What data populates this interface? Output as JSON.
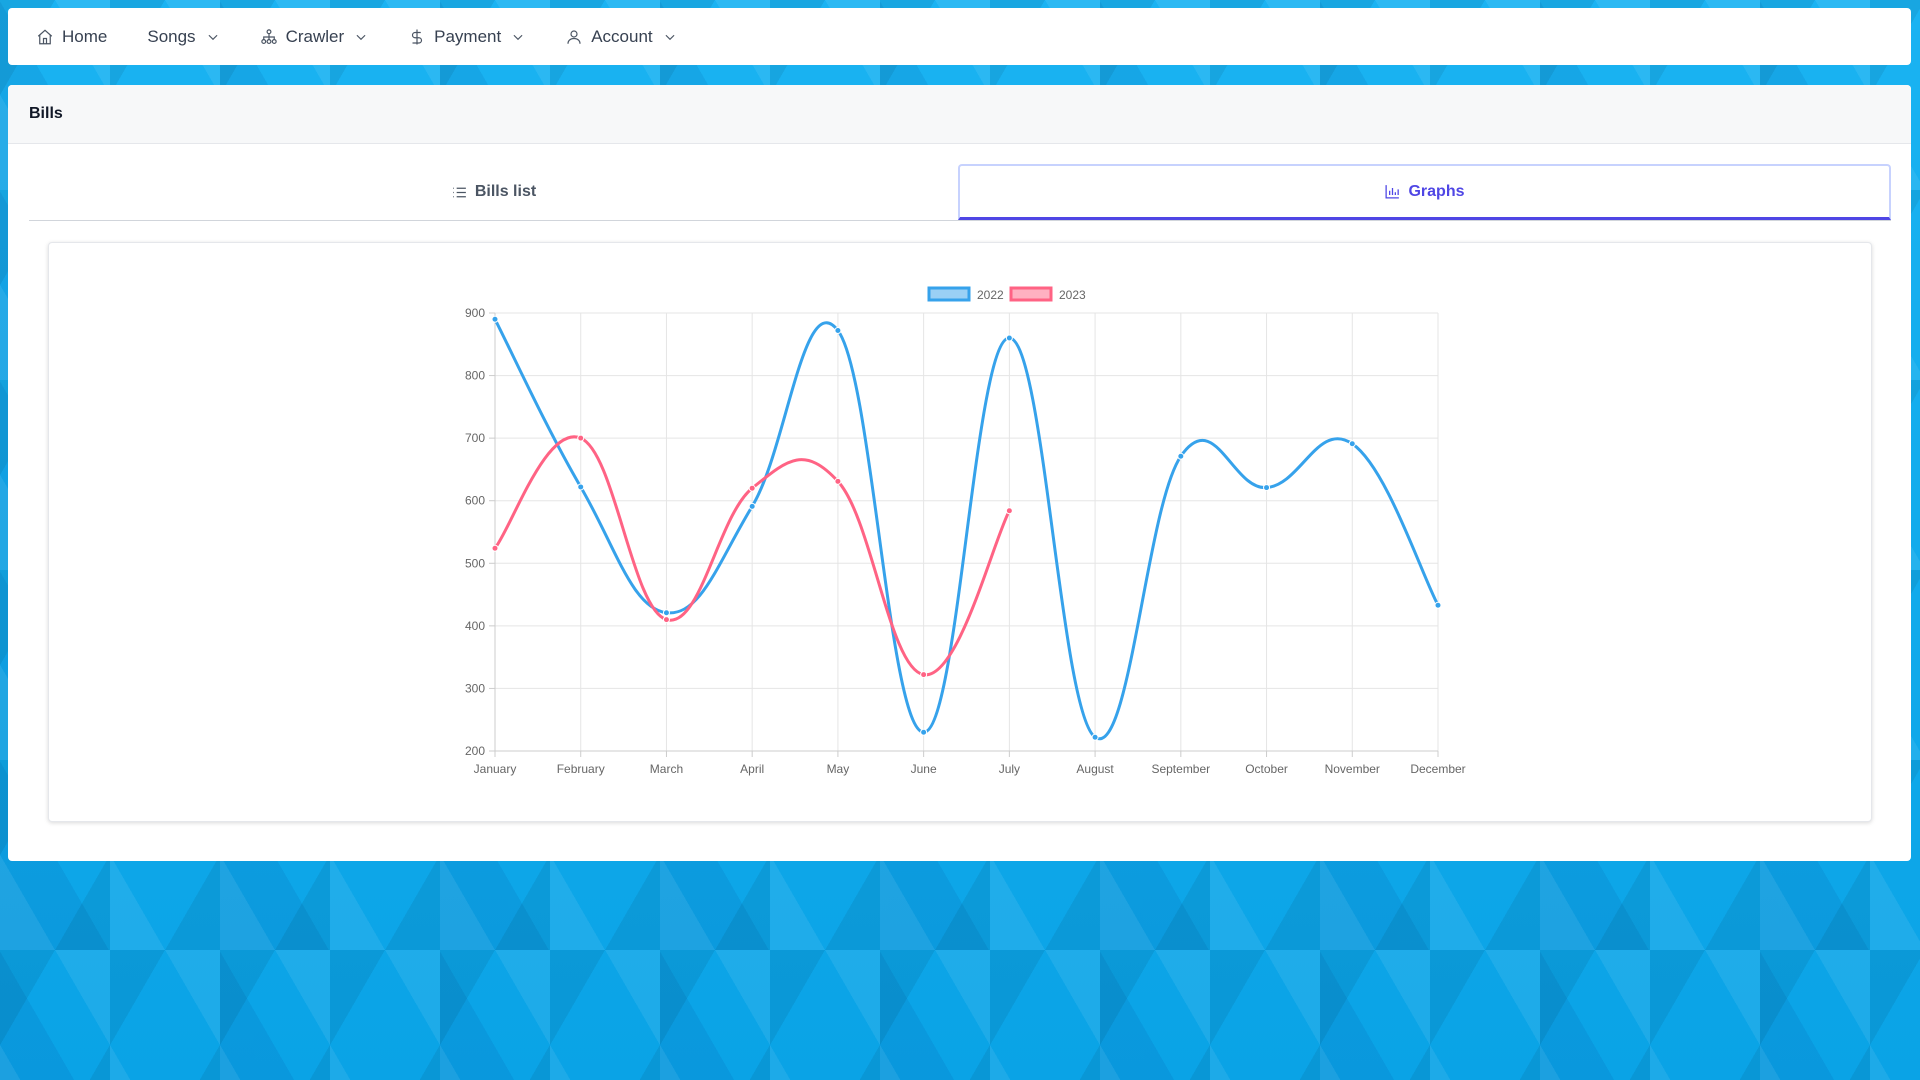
{
  "nav": {
    "items": [
      {
        "label": "Home",
        "icon": "home-icon",
        "dropdown": false
      },
      {
        "label": "Songs",
        "icon": "",
        "dropdown": true
      },
      {
        "label": "Crawler",
        "icon": "sitemap-icon",
        "dropdown": true
      },
      {
        "label": "Payment",
        "icon": "dollar-icon",
        "dropdown": true
      },
      {
        "label": "Account",
        "icon": "user-icon",
        "dropdown": true
      }
    ]
  },
  "card": {
    "title": "Bills"
  },
  "tabs": [
    {
      "label": "Bills list",
      "icon": "list-icon",
      "active": false
    },
    {
      "label": "Graphs",
      "icon": "bar-chart-icon",
      "active": true
    }
  ],
  "chart_data": {
    "type": "line",
    "categories": [
      "January",
      "February",
      "March",
      "April",
      "May",
      "June",
      "July",
      "August",
      "September",
      "October",
      "November",
      "December"
    ],
    "ylim": [
      200,
      900
    ],
    "yticks": [
      200,
      300,
      400,
      500,
      600,
      700,
      800,
      900
    ],
    "grid": true,
    "legend": "top-center",
    "series": [
      {
        "name": "2022",
        "color": "#36a2eb",
        "values": [
          890,
          622,
          421,
          591,
          872,
          230,
          860,
          222,
          671,
          621,
          691,
          433
        ]
      },
      {
        "name": "2023",
        "color": "#ff6384",
        "values": [
          524,
          700,
          410,
          620,
          631,
          322,
          584
        ]
      }
    ]
  }
}
